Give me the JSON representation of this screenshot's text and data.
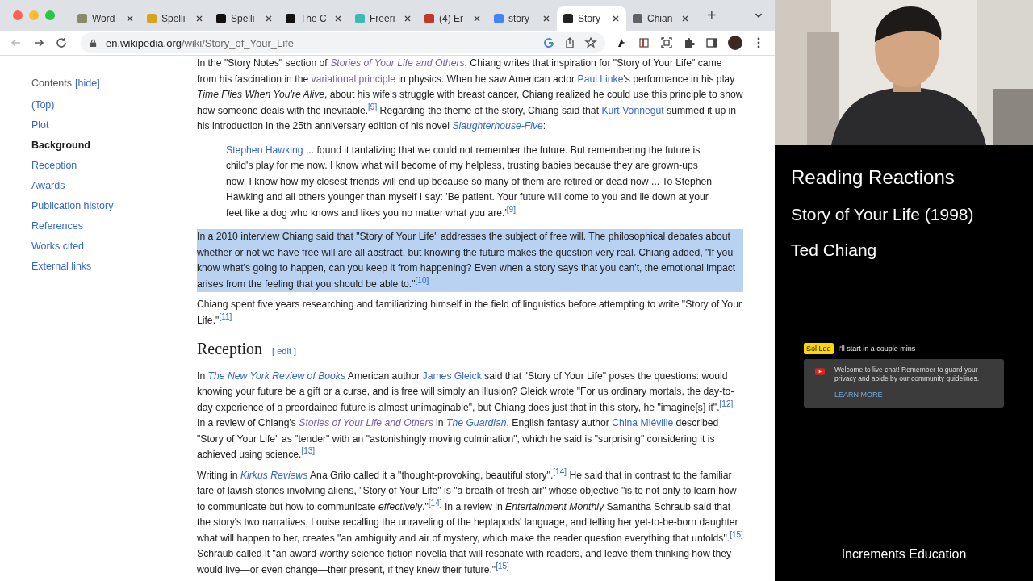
{
  "browser": {
    "tabs": [
      {
        "label": "Word",
        "selected": false,
        "color": "#8a8a6a"
      },
      {
        "label": "Spelli",
        "selected": false,
        "color": "#d9a21b"
      },
      {
        "label": "Spelli",
        "selected": false,
        "color": "#111111"
      },
      {
        "label": "The C",
        "selected": false,
        "color": "#111111"
      },
      {
        "label": "Freeri",
        "selected": false,
        "color": "#3bb9b4"
      },
      {
        "label": "(4) Er",
        "selected": false,
        "color": "#c0392b"
      },
      {
        "label": "story",
        "selected": false,
        "color": "#4285f4"
      },
      {
        "label": "Story",
        "selected": true,
        "color": "#222222"
      },
      {
        "label": "Chian",
        "selected": false,
        "color": "#5f6368"
      }
    ],
    "new_tab": "+",
    "url": {
      "host": "en.wikipedia.org",
      "path": "/wiki/Story_of_Your_Life"
    }
  },
  "sidebar": {
    "title": "Contents",
    "toggle": "[hide]",
    "items": [
      {
        "label": "(Top)",
        "selected": false
      },
      {
        "label": "Plot",
        "selected": false
      },
      {
        "label": "Background",
        "selected": true
      },
      {
        "label": "Reception",
        "selected": false
      },
      {
        "label": "Awards",
        "selected": false
      },
      {
        "label": "Publication history",
        "selected": false
      },
      {
        "label": "References",
        "selected": false
      },
      {
        "label": "Works cited",
        "selected": false
      },
      {
        "label": "External links",
        "selected": false
      }
    ]
  },
  "article": {
    "blocks": [
      {
        "kind": "paragraph",
        "highlighted": false,
        "segments": [
          {
            "kind": "text",
            "text": "In the \"Story Notes\" section of "
          },
          {
            "kind": "link",
            "text": "Stories of Your Life and Others",
            "italic": true,
            "visited": true
          },
          {
            "kind": "text",
            "text": ", Chiang writes that inspiration for \"Story of Your Life\" came from his fascination in the "
          },
          {
            "kind": "link",
            "text": "variational principle",
            "italic": false,
            "visited": true
          },
          {
            "kind": "text",
            "text": " in physics. When he saw American actor "
          },
          {
            "kind": "link",
            "text": "Paul Linke",
            "italic": false,
            "visited": false
          },
          {
            "kind": "text",
            "text": "'s performance in his play "
          },
          {
            "kind": "italic",
            "text": "Time Flies When You're Alive"
          },
          {
            "kind": "text",
            "text": ", about his wife's struggle with breast cancer, Chiang realized he could use this principle to show how someone deals with the inevitable."
          },
          {
            "kind": "ref",
            "text": "[9]"
          },
          {
            "kind": "text",
            "text": " Regarding the theme of the story, Chiang said that "
          },
          {
            "kind": "link",
            "text": "Kurt Vonnegut",
            "italic": false,
            "visited": false
          },
          {
            "kind": "text",
            "text": " summed it up in his introduction in the 25th anniversary edition of his novel "
          },
          {
            "kind": "link",
            "text": "Slaughterhouse-Five",
            "italic": true,
            "visited": false
          },
          {
            "kind": "text",
            "text": ":"
          }
        ]
      },
      {
        "kind": "quote",
        "highlighted": false,
        "segments": [
          {
            "kind": "link",
            "text": "Stephen Hawking",
            "italic": false,
            "visited": false
          },
          {
            "kind": "text",
            "text": " ... found it tantalizing that we could not remember the future. But remembering the future is child's play for me now. I know what will become of my helpless, trusting babies because they are grown-ups now. I know how my closest friends will end up because so many of them are retired or dead now ... To Stephen Hawking and all others younger than myself I say: 'Be patient. Your future will come to you and lie down at your feet like a dog who knows and likes you no matter what you are.'"
          },
          {
            "kind": "ref",
            "text": "[9]"
          }
        ]
      },
      {
        "kind": "paragraph",
        "highlighted": true,
        "segments": [
          {
            "kind": "text",
            "text": "In a 2010 interview Chiang said that \"Story of Your Life\" addresses the subject of free will. The philosophical debates about whether or not we have free will are all abstract, but knowing the future makes the question very real. Chiang added, \"If you know what's going to happen, can you keep it from happening? Even when a story says that you can't, the emotional impact arises from the feeling that you should be able to.\""
          },
          {
            "kind": "ref",
            "text": "[10]"
          }
        ]
      },
      {
        "kind": "paragraph",
        "highlighted": false,
        "segments": [
          {
            "kind": "text",
            "text": "Chiang spent five years researching and familiarizing himself in the field of linguistics before attempting to write \"Story of Your Life.\""
          },
          {
            "kind": "ref",
            "text": "[11]"
          }
        ]
      },
      {
        "kind": "heading",
        "text": "Reception",
        "edit": "[ edit ]"
      },
      {
        "kind": "paragraph",
        "highlighted": false,
        "segments": [
          {
            "kind": "text",
            "text": "In "
          },
          {
            "kind": "link",
            "text": "The New York Review of Books",
            "italic": true,
            "visited": false
          },
          {
            "kind": "text",
            "text": " American author "
          },
          {
            "kind": "link",
            "text": "James Gleick",
            "italic": false,
            "visited": false
          },
          {
            "kind": "text",
            "text": " said that \"Story of Your Life\" poses the questions: would knowing your future be a gift or a curse, and is free will simply an illusion? Gleick wrote \"For us ordinary mortals, the day-to-day experience of a preordained future is almost unimaginable\", but Chiang does just that in this story, he \"imagine[s] it\"."
          },
          {
            "kind": "ref",
            "text": "[12]"
          },
          {
            "kind": "text",
            "text": " In a review of Chiang's "
          },
          {
            "kind": "link",
            "text": "Stories of Your Life and Others",
            "italic": true,
            "visited": true
          },
          {
            "kind": "text",
            "text": " in "
          },
          {
            "kind": "link",
            "text": "The Guardian",
            "italic": true,
            "visited": false
          },
          {
            "kind": "text",
            "text": ", English fantasy author "
          },
          {
            "kind": "link",
            "text": "China Miéville",
            "italic": false,
            "visited": false
          },
          {
            "kind": "text",
            "text": " described \"Story of Your Life\" as \"tender\" with an \"astonishingly moving culmination\", which he said is \"surprising\" considering it is achieved using science."
          },
          {
            "kind": "ref",
            "text": "[13]"
          }
        ]
      },
      {
        "kind": "paragraph",
        "highlighted": false,
        "segments": [
          {
            "kind": "text",
            "text": "Writing in "
          },
          {
            "kind": "link",
            "text": "Kirkus Reviews",
            "italic": true,
            "visited": false
          },
          {
            "kind": "text",
            "text": " Ana Grilo called it a \"thought-provoking, beautiful story\"."
          },
          {
            "kind": "ref",
            "text": "[14]"
          },
          {
            "kind": "text",
            "text": " He said that in contrast to the familiar fare of lavish stories involving aliens, \"Story of Your Life\" is \"a breath of fresh air\" whose objective \"is to not only to learn how to communicate but how to communicate "
          },
          {
            "kind": "italic",
            "text": "effectively"
          },
          {
            "kind": "text",
            "text": ".\""
          },
          {
            "kind": "ref",
            "text": "[14]"
          },
          {
            "kind": "text",
            "text": " In a review in "
          },
          {
            "kind": "italic",
            "text": "Entertainment Monthly"
          },
          {
            "kind": "text",
            "text": " Samantha Schraub said that the story's two narratives, Louise recalling the unraveling of the heptapods' language, and telling her yet-to-be-born daughter what will happen to her, creates \"an ambiguity and air of mystery, which make the reader question everything that unfolds\"."
          },
          {
            "kind": "ref",
            "text": "[15]"
          },
          {
            "kind": "text",
            "text": " Schraub called it \"an award-worthy science fiction novella that will resonate with readers, and leave them thinking how they would live—or even change—their present, if they knew their future.\""
          },
          {
            "kind": "ref",
            "text": "[15]"
          }
        ]
      }
    ]
  },
  "stream_panel": {
    "title": "Reading Reactions",
    "subtitle": "Story of Your Life (1998)",
    "author": "Ted Chiang",
    "chat": {
      "messages": [
        {
          "author": "Sol Lee",
          "text": "I'll start in a couple mins"
        }
      ],
      "notice": {
        "text": "Welcome to live chat! Remember to guard your privacy and abide by our community guidelines.",
        "link": "LEARN MORE"
      }
    },
    "footer": "Increments Education"
  }
}
